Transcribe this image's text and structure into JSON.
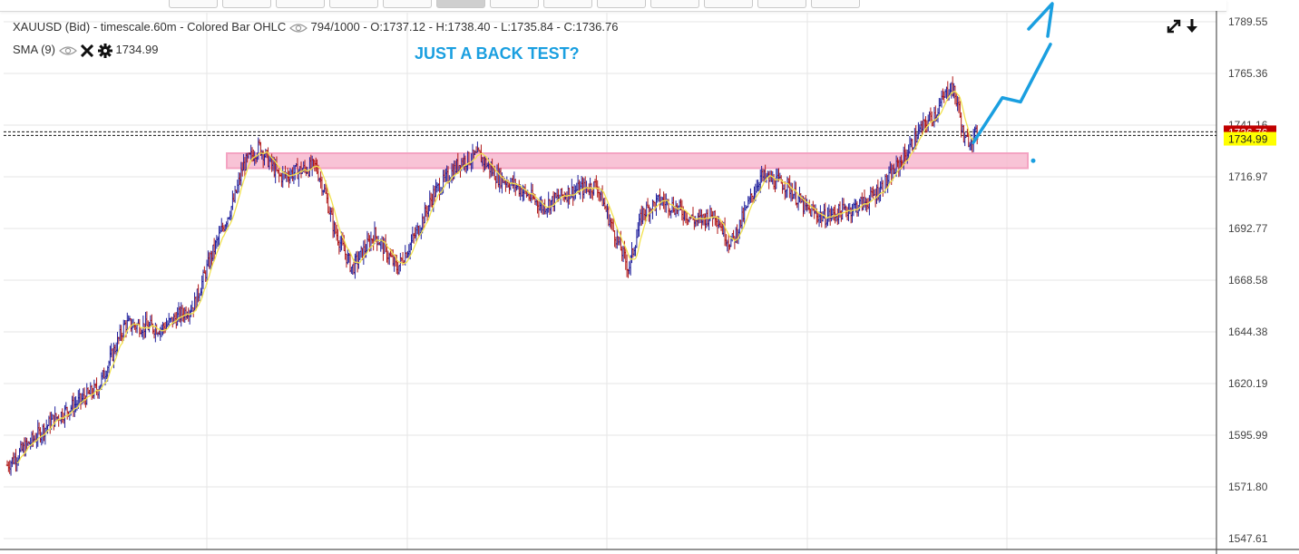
{
  "header": {
    "instrument_line": "XAUUSD (Bid) - timescale.60m - Colored Bar OHLC",
    "counter": "794/1000 - O:1737.12 - H:1738.40 - L:1735.84 - C:1736.76",
    "indicator_name": "SMA (9)",
    "indicator_value": "1734.99"
  },
  "annotation_text": "JUST A BACK TEST?",
  "toolbar": {
    "button_count": 13,
    "active_index": 5
  },
  "colors": {
    "up_bar": "#1f1f9c",
    "down_bar": "#b01616",
    "sma": "#f2e24d",
    "zone": "#f7b8cf",
    "arrow": "#1a9fe0",
    "last_price_bg": "#c00000",
    "sma_price_bg": "#ffff00"
  },
  "chart_data": {
    "type": "ohlc",
    "title": "XAUUSD (Bid) - timescale.60m - Colored Bar OHLC",
    "ylim": [
      1547.61,
      1789.55
    ],
    "y_ticks": [
      "1789.55",
      "1765.36",
      "1741.16",
      "1716.97",
      "1692.77",
      "1668.58",
      "1644.38",
      "1620.19",
      "1595.99",
      "1571.80",
      "1547.61"
    ],
    "last_close": "1736.76",
    "sma_last": "1734.99",
    "series": [
      {
        "name": "XAUUSD",
        "x": [
          0,
          50,
          100,
          130,
          170,
          206,
          225,
          250,
          260,
          270,
          278,
          300,
          340,
          350,
          360,
          380,
          405,
          430,
          455,
          470,
          500,
          520,
          540,
          560,
          590,
          620,
          650,
          668,
          685,
          700,
          720,
          740,
          760,
          780,
          795,
          800,
          830,
          860,
          880,
          900,
          930,
          950,
          970,
          990,
          1005,
          1025,
          1040,
          1048,
          1055,
          1065,
          1070
        ],
        "close": [
          1582,
          1603,
          1618,
          1648,
          1646,
          1657,
          1680,
          1706,
          1722,
          1727,
          1731,
          1717,
          1722,
          1710,
          1693,
          1674,
          1690,
          1674,
          1694,
          1709,
          1724,
          1727,
          1717,
          1713,
          1703,
          1710,
          1713,
          1692,
          1674,
          1700,
          1706,
          1702,
          1696,
          1700,
          1687,
          1687,
          1717,
          1713,
          1702,
          1698,
          1702,
          1706,
          1715,
          1727,
          1738,
          1748,
          1760,
          1751,
          1733,
          1736,
          1736.76
        ]
      }
    ],
    "sma_series": {
      "name": "SMA (9)"
    },
    "zone": {
      "low": 1721,
      "high": 1728
    },
    "arrow_path_prices": [
      1733,
      1754,
      1752,
      1779
    ]
  }
}
